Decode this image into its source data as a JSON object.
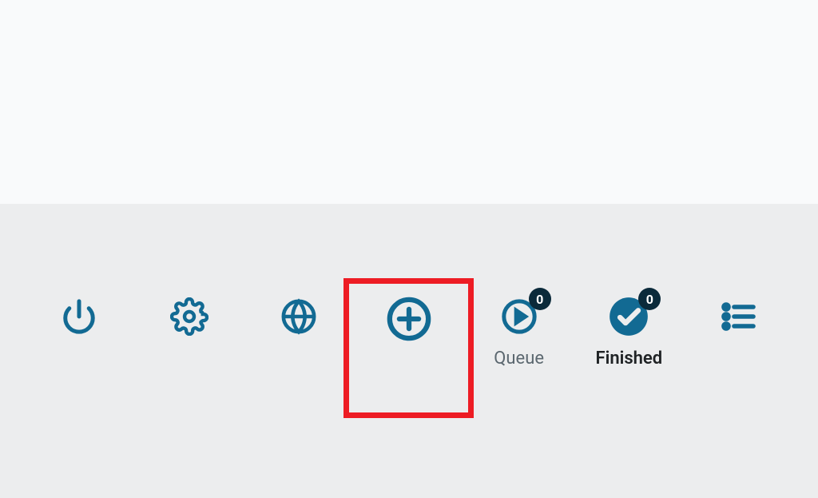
{
  "colors": {
    "icon": "#126a93",
    "badge_bg": "#0b2a3a",
    "highlight": "#ed1c24"
  },
  "toolbar": {
    "power": {
      "name": "power"
    },
    "settings": {
      "name": "settings"
    },
    "globe": {
      "name": "browser"
    },
    "add": {
      "name": "add",
      "highlighted": true
    },
    "queue": {
      "label": "Queue",
      "badge": "0"
    },
    "finished": {
      "label": "Finished",
      "badge": "0"
    },
    "list": {
      "name": "list"
    }
  }
}
